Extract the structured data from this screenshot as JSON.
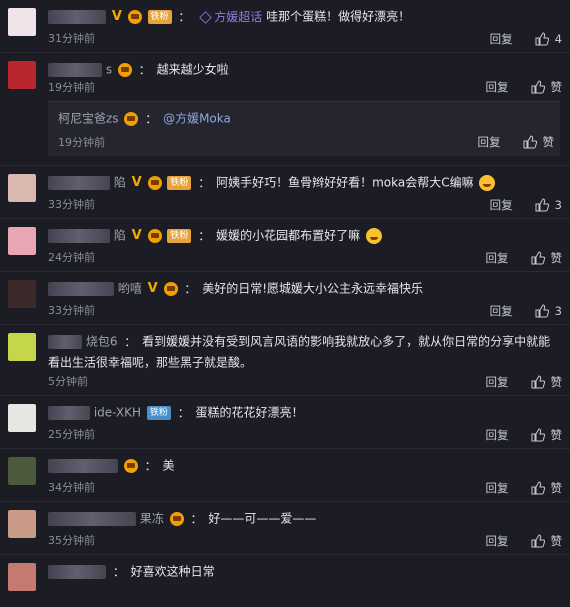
{
  "actions": {
    "reply_label": "回复",
    "like_label": "赞"
  },
  "comments": [
    {
      "name_tail": "",
      "text": "哇那个蛋糕！做得好漂亮！",
      "super_label": "方媛超话",
      "fan_label": "铁粉",
      "time": "31分钟前",
      "likes": "4",
      "avatar_color": "#f1e3ea"
    },
    {
      "name_tail": "s",
      "text": "越来越少女啦",
      "time": "19分钟前",
      "avatar_color": "#b9272e",
      "reply": {
        "name": "柯尼宝爸zs",
        "mention": "@方媛Moka",
        "time": "19分钟前"
      }
    },
    {
      "name_tail": "陷",
      "fan_label": "铁粉",
      "text": "阿姨手好巧！鱼骨辫好好看！moka会帮大C编嘛",
      "time": "33分钟前",
      "likes": "3",
      "avatar_color": "#d9b8b0"
    },
    {
      "name_tail": "陷",
      "fan_label": "铁粉",
      "text": "媛媛的小花园都布置好了嘛",
      "time": "24分钟前",
      "avatar_color": "#e9a7b5"
    },
    {
      "name_tail": "哟嘻",
      "fan_label": "",
      "text": "美好的日常!愿城媛大小公主永远幸福快乐",
      "time": "33分钟前",
      "likes": "3",
      "avatar_color": "#3c2a2a"
    },
    {
      "name_tail": "烧包6",
      "text": "看到媛媛并没有受到风言风语的影响我就放心多了，就从你日常的分享中就能看出生活很幸福呢，那些黑子就是酸。",
      "time": "5分钟前",
      "avatar_color": "#c6d64a"
    },
    {
      "name_tail": "ide-XKH",
      "fan_label": "铁粉",
      "text": "蛋糕的花花好漂亮！",
      "time": "25分钟前",
      "avatar_color": "#e7e6e2"
    },
    {
      "name_tail": "",
      "text": "美",
      "time": "34分钟前",
      "avatar_color": "#4b5a3a"
    },
    {
      "name_tail": "果冻",
      "text": "好——可——爱——",
      "time": "35分钟前",
      "avatar_color": "#c99a86"
    },
    {
      "name_tail": "",
      "text": "好喜欢这种日常",
      "avatar_color": "#c47a70"
    }
  ]
}
